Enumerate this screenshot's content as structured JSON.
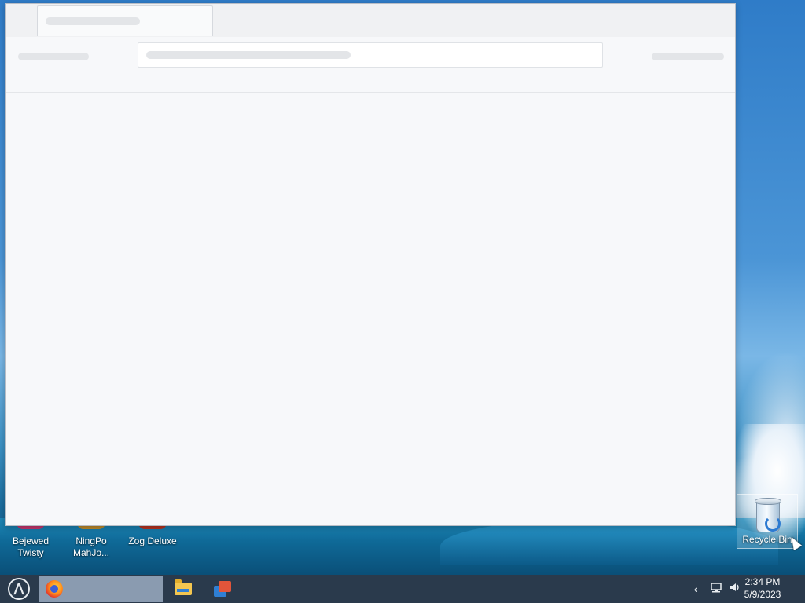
{
  "desktop": {
    "icons": [
      {
        "label": "Bejewed\nTwisty",
        "accent": "#c0356b"
      },
      {
        "label": "NingPo\nMahJo...",
        "accent": "#b8862a"
      },
      {
        "label": "Zog Deluxe",
        "accent": "#b3321f"
      },
      {
        "label": "Recycle Bin",
        "icon": "recycle-bin-icon"
      }
    ]
  },
  "window": {
    "state": "loading",
    "tab_title": "",
    "url": ""
  },
  "taskbar": {
    "start_icon": "start-menu-icon",
    "pinned": [
      {
        "name": "firefox",
        "icon": "firefox-icon",
        "active": true
      },
      {
        "name": "file-explorer",
        "icon": "folder-icon"
      },
      {
        "name": "files-app",
        "icon": "files-icon"
      }
    ],
    "tray": {
      "chevron": "‹",
      "network_icon": "network-icon",
      "volume_icon": "volume-icon"
    },
    "clock": {
      "time": "2:34 PM",
      "date": "5/9/2023"
    }
  }
}
